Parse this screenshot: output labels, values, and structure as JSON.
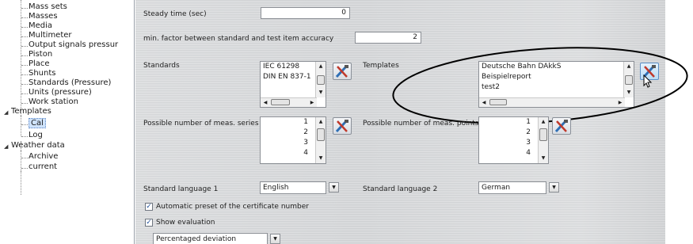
{
  "tree": {
    "items": [
      {
        "label": "Mass sets"
      },
      {
        "label": "Masses"
      },
      {
        "label": "Media"
      },
      {
        "label": "Multimeter"
      },
      {
        "label": "Output signals pressur"
      },
      {
        "label": "Piston"
      },
      {
        "label": "Place"
      },
      {
        "label": "Shunts"
      },
      {
        "label": "Standards (Pressure)"
      },
      {
        "label": "Units (pressure)"
      },
      {
        "label": "Work station"
      },
      {
        "label": "Templates"
      },
      {
        "label": "Cal"
      },
      {
        "label": "Log"
      },
      {
        "label": "Weather data"
      },
      {
        "label": "Archive"
      },
      {
        "label": "current"
      }
    ]
  },
  "form": {
    "steady_time": {
      "label": "Steady time (sec)",
      "value": "0"
    },
    "min_factor": {
      "label": "min. factor between standard and test item accuracy",
      "value": "2"
    },
    "standards": {
      "label": "Standards",
      "items": [
        "IEC 61298",
        "DIN EN 837-1"
      ]
    },
    "templates": {
      "label": "Templates",
      "items": [
        "Deutsche Bahn DAkkS",
        "Beispielreport",
        "test2"
      ]
    },
    "meas_series": {
      "label": "Possible number of meas. series",
      "items": [
        "1",
        "2",
        "3",
        "4"
      ]
    },
    "meas_points": {
      "label": "Possible number of meas. points",
      "items": [
        "1",
        "2",
        "3",
        "4"
      ]
    },
    "lang1": {
      "label": "Standard language 1",
      "value": "English"
    },
    "lang2": {
      "label": "Standard language 2",
      "value": "German"
    },
    "auto_preset": {
      "label": "Automatic preset of the certificate number",
      "checked": true
    },
    "show_eval": {
      "label": "Show evaluation",
      "checked": true
    },
    "evaluation": {
      "value": "Percentaged deviation"
    }
  },
  "icons": {
    "edit": "tools-icon",
    "scroll_up": "arrow-up-icon",
    "scroll_down": "arrow-down-icon",
    "dropdown": "chevron-down-icon",
    "cursor": "mouse-pointer-icon"
  },
  "colors": {
    "panel": "#d4d6d8",
    "selection": "#cfe3fb",
    "annotation_ellipse": "#000000"
  }
}
